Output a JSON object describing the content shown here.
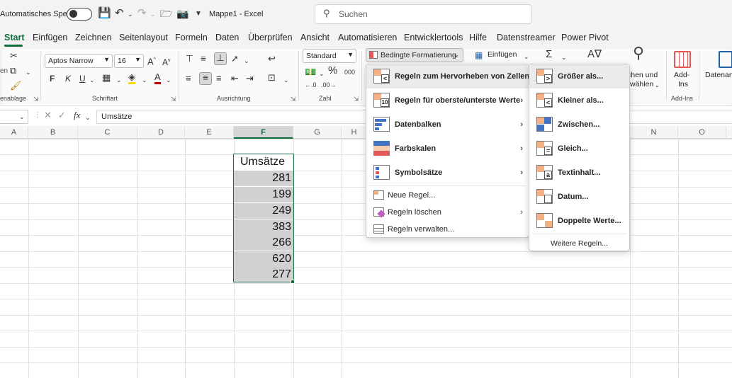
{
  "titlebar": {
    "autosave_label": "Automatisches Speichern",
    "doc_title": "Mappe1  -  Excel",
    "search_placeholder": "Suchen"
  },
  "tabs": [
    "Start",
    "Einfügen",
    "Zeichnen",
    "Seitenlayout",
    "Formeln",
    "Daten",
    "Überprüfen",
    "Ansicht",
    "Automatisieren",
    "Entwicklertools",
    "Hilfe",
    "Datenstreamer",
    "Power Pivot"
  ],
  "ribbon": {
    "font_name": "Aptos Narrow",
    "font_size": "16",
    "number_format": "Standard",
    "conditional_formatting": "Bedingte Formatierung",
    "insert_cells": "Einfügen",
    "find_select_1": "chen und",
    "find_select_2": "wählen",
    "addins_1": "Add-",
    "addins_2": "Ins",
    "datenanalyse": "Datenan",
    "clipboard_partial": "en",
    "groups": {
      "clipboard": "enablage",
      "font": "Schriftart",
      "alignment": "Ausrichtung",
      "number": "Zahl",
      "addins": "Add-Ins"
    },
    "bold": "F",
    "italic": "K",
    "underline": "U",
    "percent": "%",
    "thousands": "000"
  },
  "formulabar": {
    "fx": "fx",
    "content": "Umsätze"
  },
  "columns": [
    "A",
    "B",
    "C",
    "D",
    "E",
    "F",
    "G",
    "H",
    "N",
    "O"
  ],
  "sheet": {
    "header": "Umsätze",
    "values": [
      "281",
      "199",
      "249",
      "383",
      "266",
      "620",
      "277"
    ]
  },
  "menu_main": {
    "items": [
      {
        "label": "Regeln zum Hervorheben von Zellen",
        "icon": "highlight-cells-rules-icon"
      },
      {
        "label": "Regeln für oberste/unterste Werte",
        "icon": "top-bottom-rules-icon"
      },
      {
        "label": "Datenbalken",
        "icon": "data-bars-icon"
      },
      {
        "label": "Farbskalen",
        "icon": "color-scales-icon"
      },
      {
        "label": "Symbolsätze",
        "icon": "icon-sets-icon"
      }
    ],
    "small_items": [
      {
        "label": "Neue Regel...",
        "icon": "new-rule-icon"
      },
      {
        "label": "Regeln löschen",
        "icon": "clear-rules-icon"
      },
      {
        "label": "Regeln verwalten...",
        "icon": "manage-rules-icon"
      }
    ]
  },
  "menu_sub": {
    "items": [
      {
        "label": "Größer als...",
        "icon": "greater-than-icon",
        "glyph": ">"
      },
      {
        "label": "Kleiner als...",
        "icon": "less-than-icon",
        "glyph": "<"
      },
      {
        "label": "Zwischen...",
        "icon": "between-icon",
        "glyph": ""
      },
      {
        "label": "Gleich...",
        "icon": "equal-to-icon",
        "glyph": "="
      },
      {
        "label": "Textinhalt...",
        "icon": "text-contains-icon",
        "glyph": "a"
      },
      {
        "label": "Datum...",
        "icon": "date-occurring-icon",
        "glyph": ""
      },
      {
        "label": "Doppelte Werte...",
        "icon": "duplicate-values-icon",
        "glyph": ""
      }
    ],
    "more": "Weitere Regeln..."
  },
  "colors": {
    "accent": "#0f6c3b",
    "selection_border": "#1e7145",
    "cell_fill": "#d1d1d1",
    "icon_orange": "#f4b183",
    "icon_blue": "#4472c4",
    "icon_red": "#e05a5a"
  }
}
